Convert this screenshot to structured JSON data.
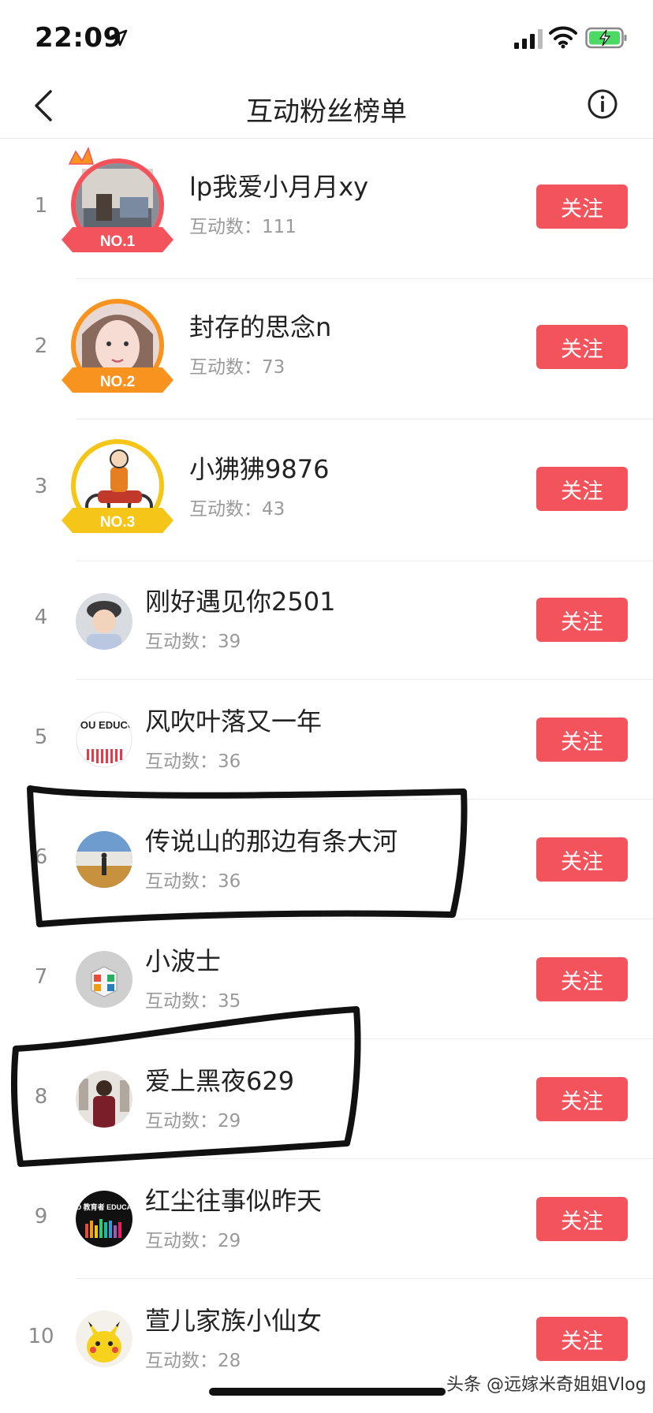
{
  "status_bar": {
    "time": "22:09"
  },
  "nav": {
    "title": "互动粉丝榜单",
    "back_icon": "chevron-left-icon",
    "info_icon": "info-icon"
  },
  "follow_label": "关注",
  "count_prefix": "互动数：",
  "colors": {
    "follow_button": "#f3545c",
    "rank1": "#f3545c",
    "rank2": "#f7931e",
    "rank3": "#f5c518"
  },
  "fans": [
    {
      "rank": "1",
      "name": "lp我爱小月月xy",
      "count": "111",
      "badge": "NO.1"
    },
    {
      "rank": "2",
      "name": "封存的思念n",
      "count": "73",
      "badge": "NO.2"
    },
    {
      "rank": "3",
      "name": "小狒狒9876",
      "count": "43",
      "badge": "NO.3"
    },
    {
      "rank": "4",
      "name": "刚好遇见你2501",
      "count": "39"
    },
    {
      "rank": "5",
      "name": "风吹叶落又一年",
      "count": "36",
      "avatar_text": "WE ♥ YOU EDUCOTARS"
    },
    {
      "rank": "6",
      "name": "传说山的那边有条大河",
      "count": "36"
    },
    {
      "rank": "7",
      "name": "小波士",
      "count": "35"
    },
    {
      "rank": "8",
      "name": "爱上黑夜629",
      "count": "29"
    },
    {
      "rank": "9",
      "name": "红尘往事似昨天",
      "count": "29",
      "avatar_text": "HELLO 教育者 EDUCATORS"
    },
    {
      "rank": "10",
      "name": "萱儿家族小仙女",
      "count": "28"
    }
  ],
  "watermark": "头条 @远嫁米奇姐姐Vlog"
}
